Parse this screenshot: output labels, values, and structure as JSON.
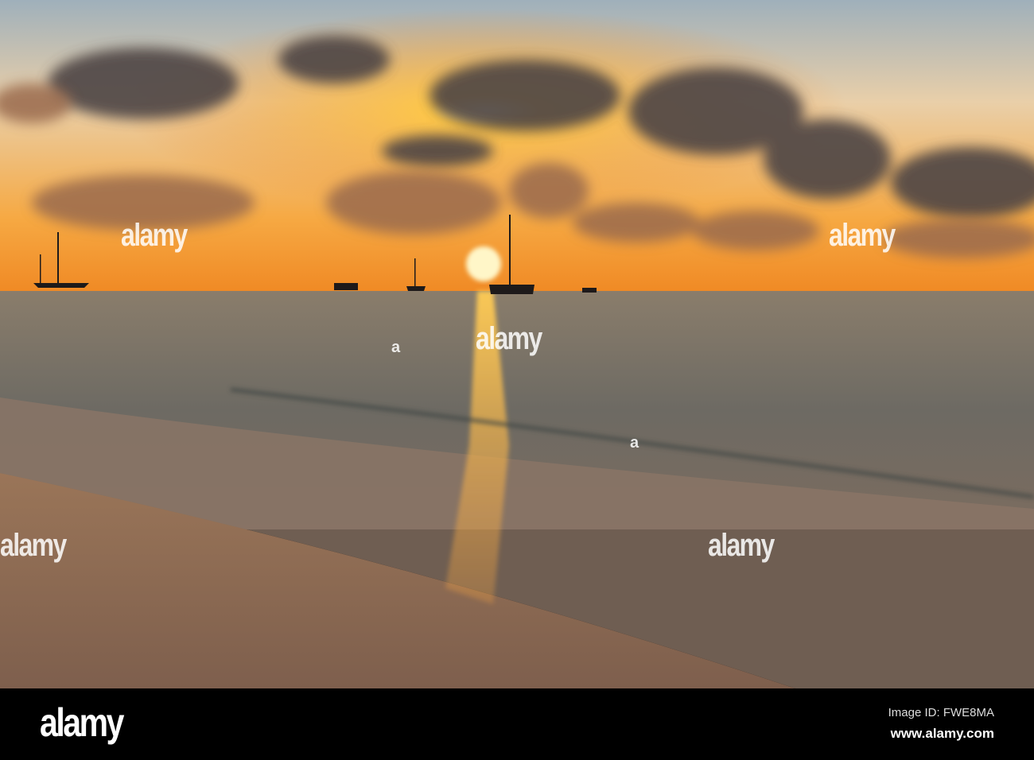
{
  "watermark": {
    "logo": "alamy",
    "image_id": "Image ID: FWE8MA",
    "url": "www.alamy.com"
  },
  "watermarks": {
    "repeated_logo": "alamy",
    "dot": "a"
  },
  "colors": {
    "sky_top": "#a9b7bf",
    "sky_glow": "#f59a2a",
    "sun": "#fff3b0",
    "sea": "#6f6a62",
    "sand": "#8a6a55",
    "cloud": "#4d4545"
  }
}
